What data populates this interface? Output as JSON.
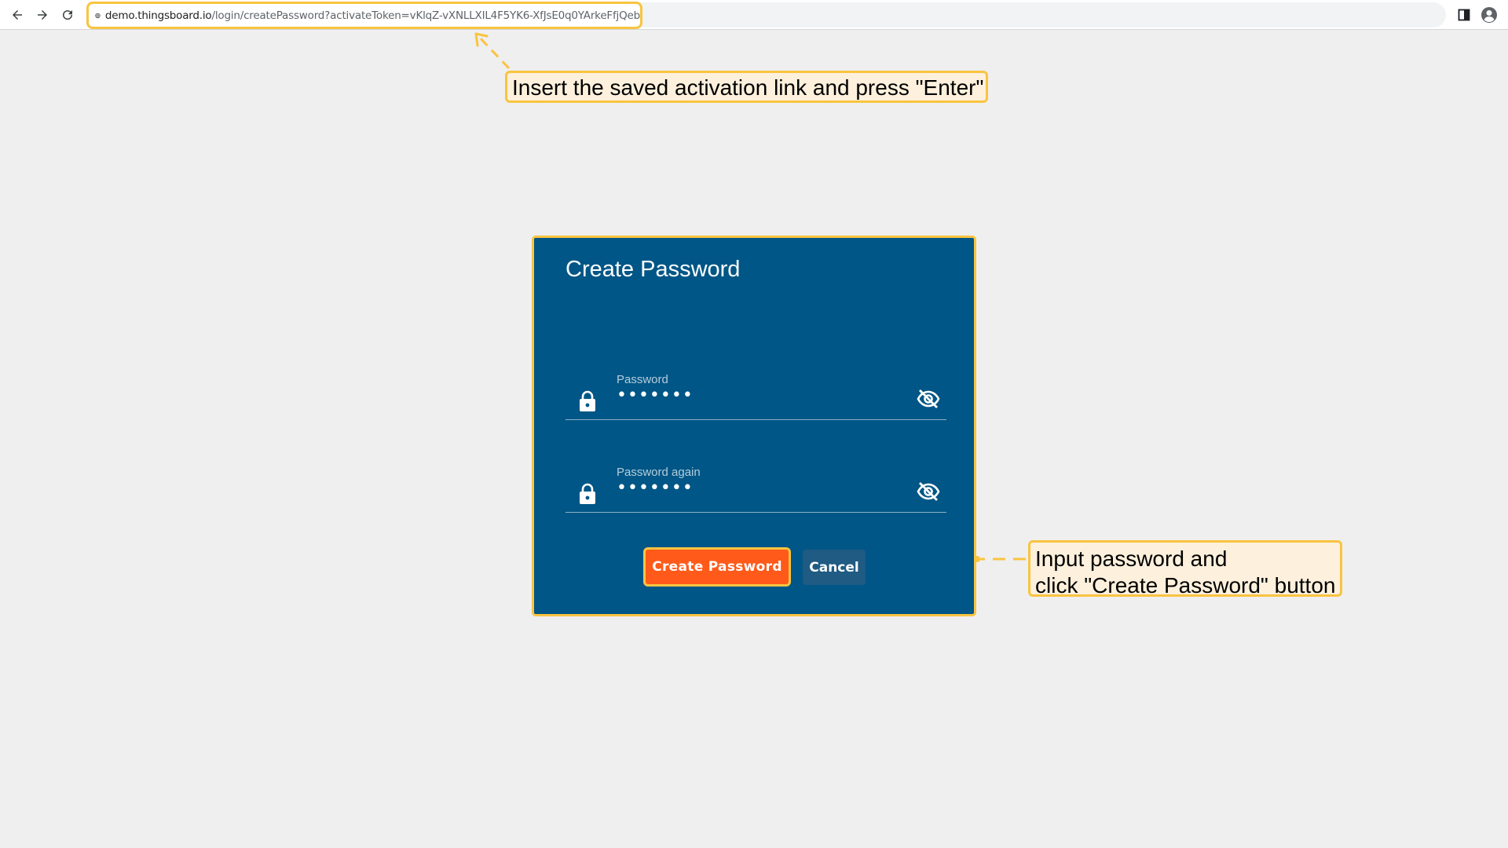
{
  "browser": {
    "url_host": "demo.thingsboard.io",
    "url_path": "/login/createPassword?activateToken=vKlqZ-vXNLLXIL4F5YK6-XfJsE0q0YArkeFfjQeb",
    "icons": [
      "back-arrow-icon",
      "forward-arrow-icon",
      "reload-icon",
      "site-info-icon",
      "side-panel-icon",
      "profile-icon"
    ]
  },
  "callouts": {
    "top": "Insert the saved activation link and press \"Enter\"",
    "right_line1": "Input password and",
    "right_line2": "click \"Create Password\" button"
  },
  "card": {
    "title": "Create Password",
    "password_label": "Password",
    "password_value": "•••••••",
    "password_again_label": "Password again",
    "password_again_value": "•••••••",
    "create_button": "Create Password",
    "cancel_button": "Cancel"
  },
  "colors": {
    "card_bg": "#005686",
    "highlight": "#f9c440",
    "primary_button": "#ff5a1a",
    "callout_bg": "#fdf0dc",
    "page_bg": "#efefef"
  }
}
